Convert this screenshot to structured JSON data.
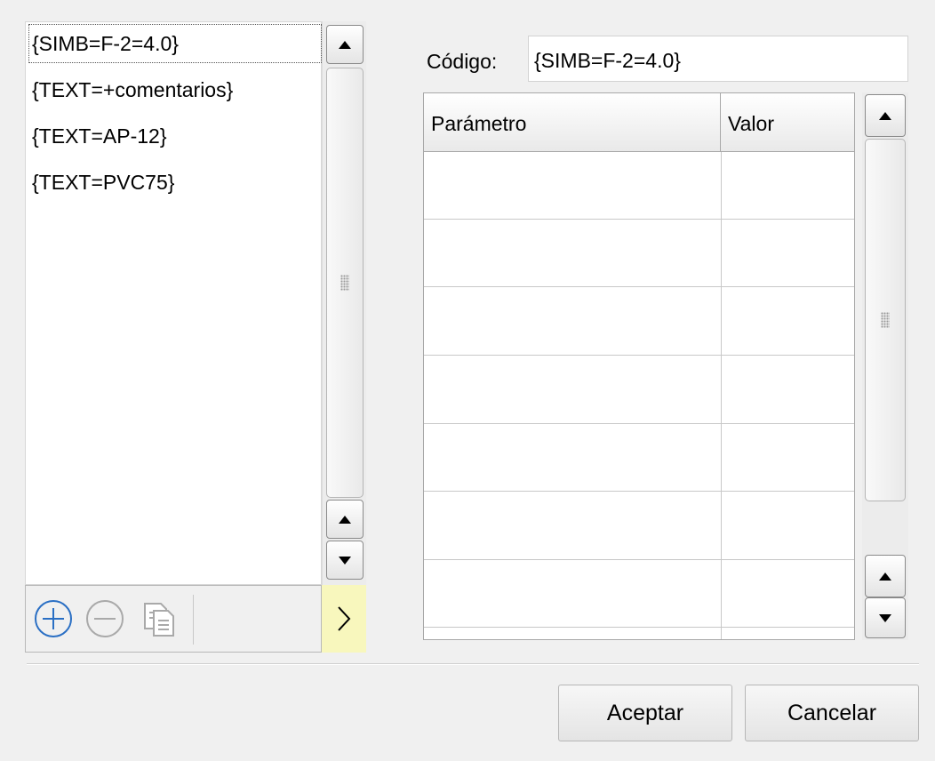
{
  "list": {
    "items": [
      {
        "label": "{SIMB=F-2=4.0}",
        "selected": true
      },
      {
        "label": "{TEXT=+comentarios}",
        "selected": false
      },
      {
        "label": "{TEXT=AP-12}",
        "selected": false
      },
      {
        "label": "{TEXT=PVC75}",
        "selected": false
      }
    ]
  },
  "toolbar": {
    "add_icon": "add-circle-icon",
    "remove_icon": "remove-circle-icon",
    "copy_icon": "copy-document-icon",
    "expand_icon": "chevron-right-icon",
    "add_color": "#2a6fc4",
    "disabled_color": "#a9a9a9",
    "expand_bg": "#f8f7bd"
  },
  "code": {
    "label": "Código:",
    "value": "{SIMB=F-2=4.0}"
  },
  "table": {
    "headers": [
      "Parámetro",
      "Valor"
    ],
    "rows": [
      [
        "",
        ""
      ],
      [
        "",
        ""
      ],
      [
        "",
        ""
      ],
      [
        "",
        ""
      ],
      [
        "",
        ""
      ],
      [
        "",
        ""
      ],
      [
        "",
        ""
      ]
    ]
  },
  "buttons": {
    "accept": "Aceptar",
    "cancel": "Cancelar"
  }
}
